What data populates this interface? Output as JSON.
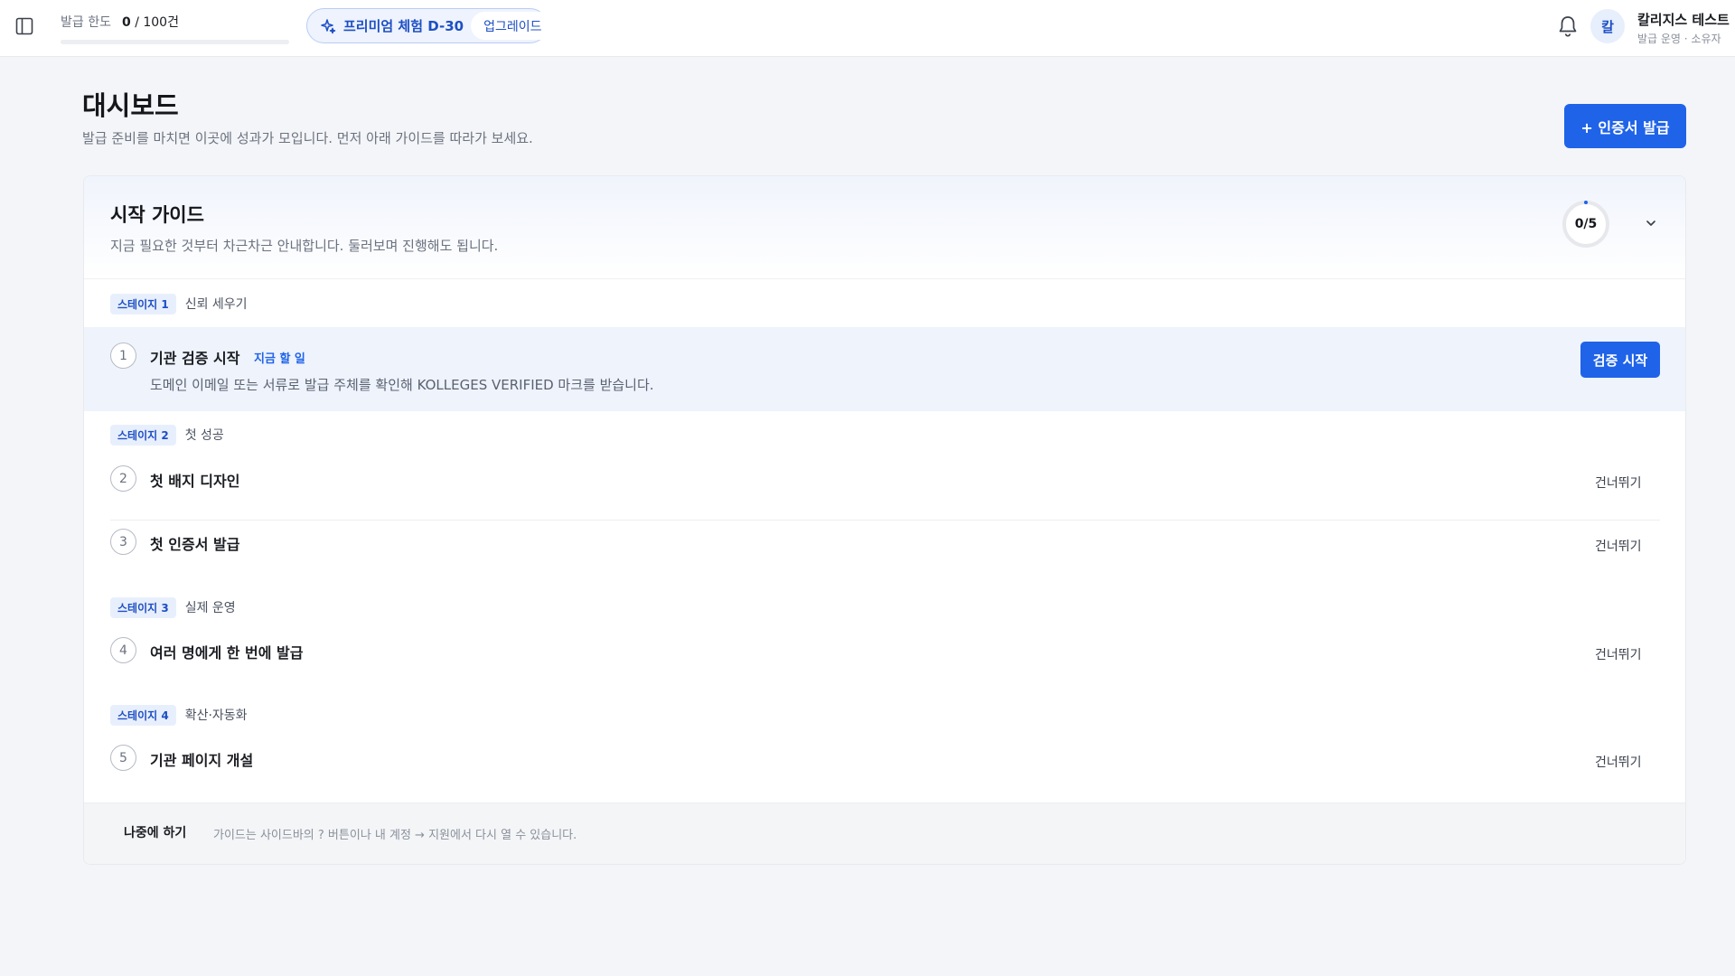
{
  "topbar": {
    "sidebar_toggle_icon": "sidebar-panel-icon",
    "quota_label": "발급 한도",
    "quota_used": "0",
    "quota_total": "/ 100건",
    "quota_fraction": 0,
    "trial_icon": "sparkle-icon",
    "trial_label": "프리미엄 체험 D-30",
    "upgrade_label": "업그레이드",
    "bell_icon": "bell-icon",
    "avatar_initial": "칼",
    "user_name": "칼리지스 테스트",
    "user_role": "발급 운영 · 소유자"
  },
  "header": {
    "title": "대시보드",
    "subtitle": "발급 준비를 마치면 이곳에 성과가 모입니다. 먼저 아래 가이드를 따라가 보세요.",
    "issue_button": "+ 인증서 발급"
  },
  "guide": {
    "title": "시작 가이드",
    "description": "지금 필요한 것부터 차근차근 안내합니다. 둘러보며 진행해도 됩니다.",
    "progress_text": "0/5",
    "progress_fraction": 0,
    "collapse_icon": "chevron-down-icon",
    "stages": [
      {
        "badge": "스테이지 1",
        "name": "신뢰 세우기"
      },
      {
        "badge": "스테이지 2",
        "name": "첫 성공"
      },
      {
        "badge": "스테이지 3",
        "name": "실제 운영"
      },
      {
        "badge": "스테이지 4",
        "name": "확산·자동화"
      }
    ],
    "steps": [
      {
        "num": "1",
        "title": "기관 검증 시작",
        "tag": "지금 할 일",
        "desc": "도메인 이메일 또는 서류로 발급 주체를 확인해 KOLLEGES VERIFIED 마크를 받습니다.",
        "action": "검증 시작"
      },
      {
        "num": "2",
        "title": "첫 배지 디자인",
        "action": "건너뛰기"
      },
      {
        "num": "3",
        "title": "첫 인증서 발급",
        "action": "건너뛰기"
      },
      {
        "num": "4",
        "title": "여러 명에게 한 번에 발급",
        "action": "건너뛰기"
      },
      {
        "num": "5",
        "title": "기관 페이지 개설",
        "action": "건너뛰기"
      }
    ],
    "later_label": "나중에 하기",
    "footer_hint": "가이드는 사이드바의 ? 버튼이나 내 계정 → 지원에서 다시 열 수 있습니다."
  },
  "colors": {
    "accent": "#1f63e9",
    "background": "#f4f5f8",
    "active_row": "#eef3fc"
  }
}
